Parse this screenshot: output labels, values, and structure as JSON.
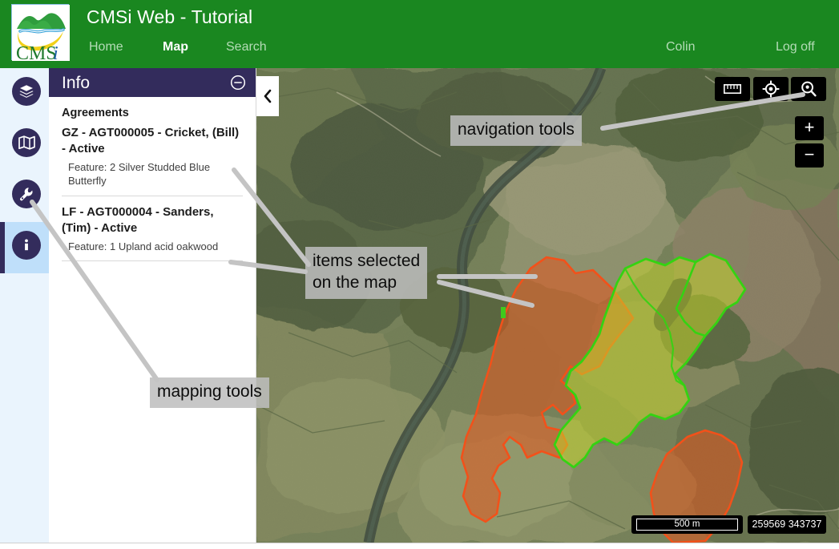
{
  "header": {
    "title": "CMSi Web - Tutorial",
    "logo_text_main": "CMS",
    "logo_text_italic": "i",
    "nav": [
      {
        "label": "Home",
        "active": false
      },
      {
        "label": "Map",
        "active": true
      },
      {
        "label": "Search",
        "active": false
      }
    ],
    "user": "Colin",
    "logoff": "Log off",
    "brand_green": "#1a8720"
  },
  "sidebar": {
    "items": [
      {
        "name": "layers",
        "icon": "layers-icon",
        "active": false
      },
      {
        "name": "basemap",
        "icon": "map-icon",
        "active": false
      },
      {
        "name": "tools",
        "icon": "wrench-icon",
        "active": false
      },
      {
        "name": "info",
        "icon": "info-icon",
        "active": true
      }
    ],
    "active_bg": "#bfdffa",
    "panel_bg": "#eaf4fd",
    "accent": "#332c5c"
  },
  "info_panel": {
    "title": "Info",
    "collapse_icon": "minus-circle-icon",
    "section_heading": "Agreements",
    "agreements": [
      {
        "title": "GZ - AGT000005 - Cricket, (Bill) - Active",
        "feature": "Feature: 2 Silver Studded Blue Butterfly"
      },
      {
        "title": "LF - AGT000004 - Sanders, (Tim) - Active",
        "feature": "Feature: 1 Upland acid oakwood"
      }
    ],
    "tab_icon": "chevron-left-icon"
  },
  "map": {
    "tools": [
      {
        "name": "measure",
        "icon": "ruler-icon"
      },
      {
        "name": "locate",
        "icon": "crosshair-icon"
      },
      {
        "name": "search",
        "icon": "magnifier-pin-icon"
      }
    ],
    "zoom_in": "+",
    "zoom_out": "−",
    "scale_label": "500 m",
    "coordinates": "259569 343737",
    "polygon_colors": {
      "agreement_orange_stroke": "#f04f18",
      "agreement_orange_fill": "#e8611f",
      "agreement_green_stroke": "#39d91f",
      "agreement_green_fill": "#c6d62a"
    }
  },
  "annotations": [
    {
      "name": "navigation-tools",
      "text": "navigation tools"
    },
    {
      "name": "items-selected",
      "text": "items selected\non the map"
    },
    {
      "name": "mapping-tools",
      "text": "mapping tools"
    }
  ]
}
